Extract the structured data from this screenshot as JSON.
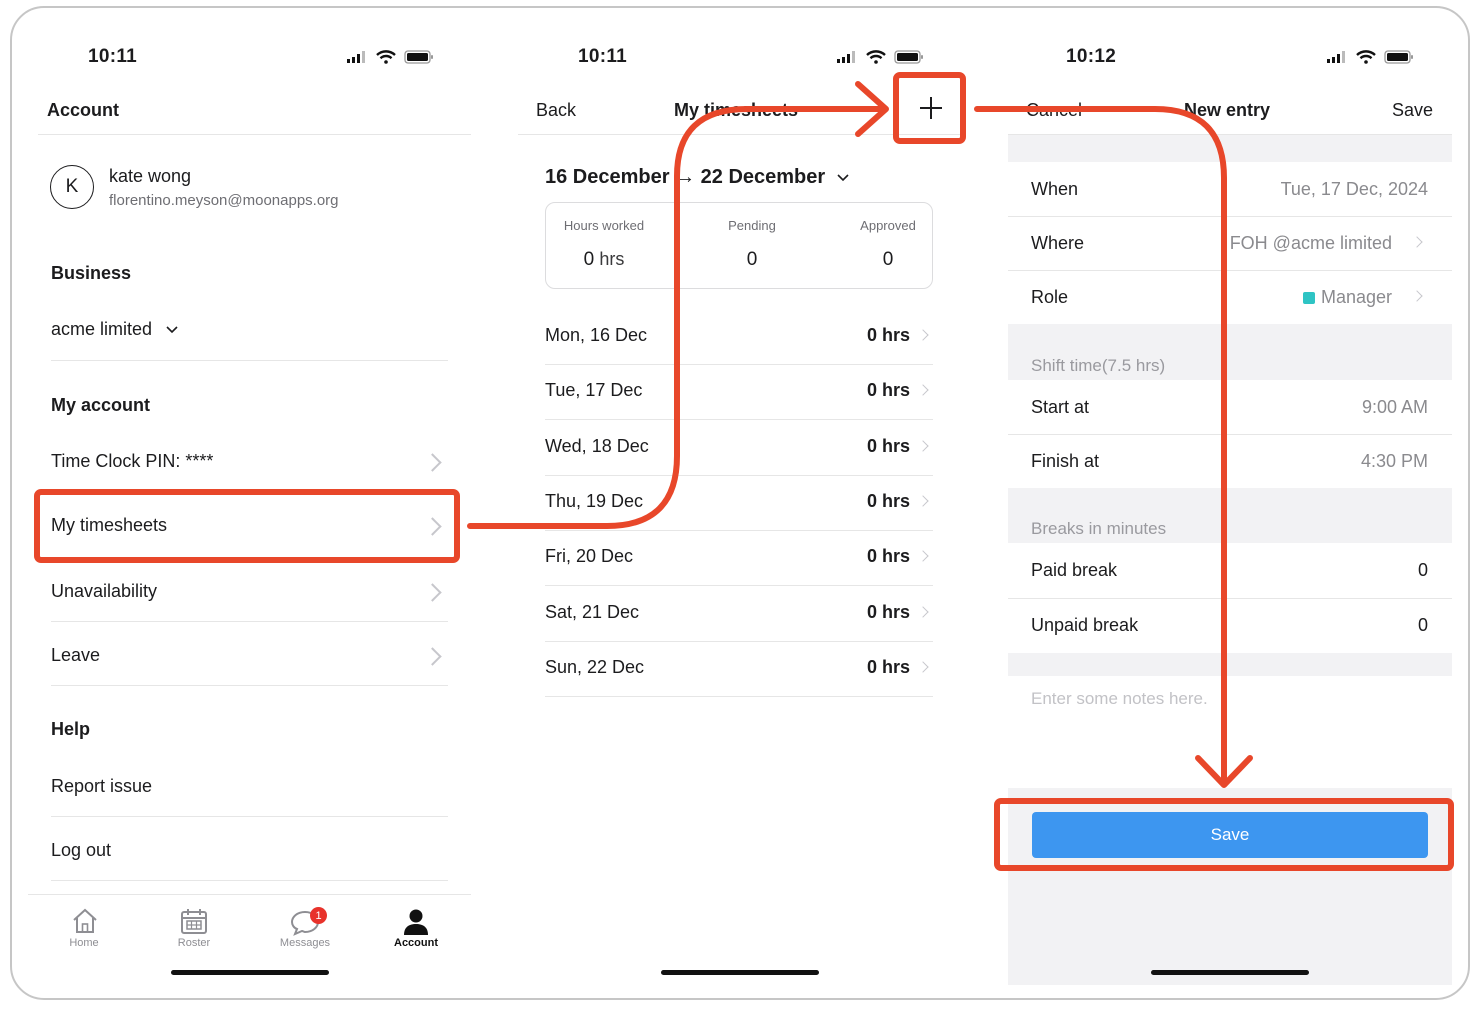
{
  "screen1": {
    "status_time": "10:11",
    "header_title": "Account",
    "user": {
      "avatar_letter": "K",
      "name": "kate wong",
      "email": "florentino.meyson@moonapps.org"
    },
    "business_heading": "Business",
    "business_name": "acme limited",
    "my_account_heading": "My account",
    "items": [
      "Time Clock PIN: ****",
      "My timesheets",
      "Unavailability",
      "Leave"
    ],
    "help_heading": "Help",
    "report_issue": "Report issue",
    "log_out": "Log out",
    "tabs": [
      "Home",
      "Roster",
      "Messages",
      "Account"
    ],
    "messages_badge": "1"
  },
  "screen2": {
    "status_time": "10:11",
    "back_label": "Back",
    "title": "My timesheets",
    "range_label": "16 December → 22 December",
    "summary": {
      "hours_worked_label": "Hours worked",
      "hours_worked_value": "0",
      "hours_unit": "hrs",
      "pending_label": "Pending",
      "pending_value": "0",
      "approved_label": "Approved",
      "approved_value": "0"
    },
    "days": [
      {
        "day": "Mon, 16 Dec",
        "hours": "0 hrs"
      },
      {
        "day": "Tue, 17 Dec",
        "hours": "0 hrs"
      },
      {
        "day": "Wed, 18 Dec",
        "hours": "0 hrs"
      },
      {
        "day": "Thu, 19 Dec",
        "hours": "0 hrs"
      },
      {
        "day": "Fri, 20 Dec",
        "hours": "0 hrs"
      },
      {
        "day": "Sat, 21 Dec",
        "hours": "0 hrs"
      },
      {
        "day": "Sun, 22 Dec",
        "hours": "0 hrs"
      }
    ]
  },
  "screen3": {
    "status_time": "10:12",
    "cancel_label": "Cancel",
    "title": "New entry",
    "save_label": "Save",
    "when_label": "When",
    "when_value": "Tue, 17 Dec, 2024",
    "where_label": "Where",
    "where_value": "FOH @acme limited",
    "role_label": "Role",
    "role_value": "Manager",
    "role_color": "#2ec4c4",
    "shift_header": "Shift time(7.5 hrs)",
    "start_label": "Start at",
    "start_value": "9:00 AM",
    "finish_label": "Finish at",
    "finish_value": "4:30 PM",
    "breaks_header": "Breaks in minutes",
    "paid_label": "Paid break",
    "paid_value": "0",
    "unpaid_label": "Unpaid break",
    "unpaid_value": "0",
    "notes_placeholder": "Enter some notes here.",
    "save_button": "Save"
  },
  "colors": {
    "annotation": "#e8472a",
    "primary": "#3d96f0",
    "badge": "#e8322b"
  }
}
